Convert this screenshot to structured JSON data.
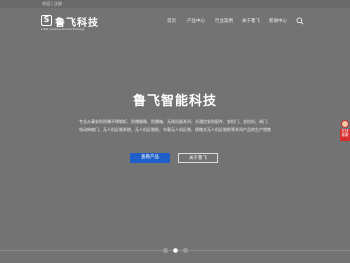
{
  "topbar": {
    "welcome": "欢迎 | 注册"
  },
  "logo": {
    "mark": "S",
    "name": "鲁飞科技",
    "subtitle": "Lufei science and technology"
  },
  "nav": {
    "items": [
      {
        "label": "首页"
      },
      {
        "label": "产品中心"
      },
      {
        "label": "行业案例"
      },
      {
        "label": "关于鲁飞"
      },
      {
        "label": "新闻中心"
      }
    ]
  },
  "hero": {
    "title": "鲁飞智能科技",
    "description_line1": "专业从事安防防爆不锈钢柜、防爆摄像、防爆箱、无线机器系列、光通信安防配件、安检门、金检机、闸门、",
    "description_line2": "电动伸缩门、无人机反制系统、无人机反制枪、车载无人机反制、便携式无人机反制枪等系列产品的生产销售"
  },
  "buttons": {
    "primary": "查看产品",
    "secondary": "关于鲁飞"
  },
  "slider": {
    "dot_count": 3,
    "active_index": 1
  },
  "float_widget": {
    "label": "在线客服"
  },
  "icons": {
    "search": "search-icon",
    "logo_mark": "shield-s-icon",
    "avatar": "avatar-icon"
  },
  "colors": {
    "background": "#737373",
    "primary_button": "#1f5fc9",
    "widget_red": "#d72d2d"
  }
}
